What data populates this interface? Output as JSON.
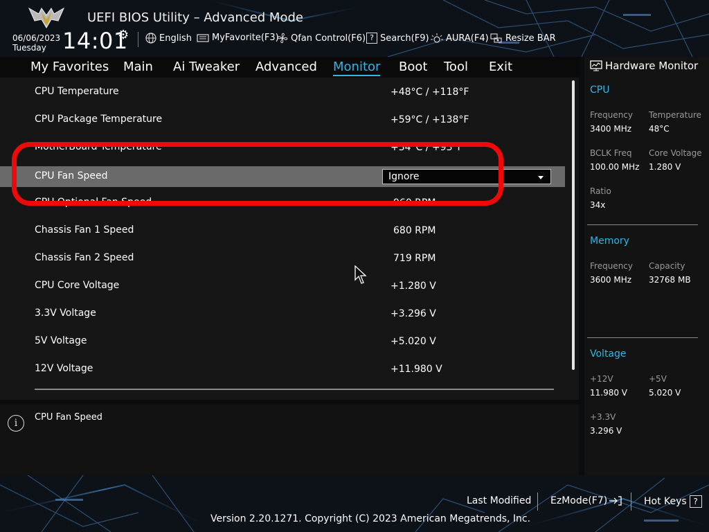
{
  "header": {
    "title": "UEFI BIOS Utility – Advanced Mode",
    "date": "06/06/2023",
    "day": "Tuesday",
    "time": "14:01",
    "items": [
      {
        "label": "English",
        "icon": "globe-icon"
      },
      {
        "label": "MyFavorite(F3)",
        "icon": "keyboard-icon"
      },
      {
        "label": "Qfan Control(F6)",
        "icon": "fan-icon"
      },
      {
        "label": "Search(F9)",
        "icon": "search-icon"
      },
      {
        "label": "AURA(F4)",
        "icon": "aura-icon"
      },
      {
        "label": "Resize BAR",
        "icon": "resize-bar-icon"
      }
    ]
  },
  "tabs": [
    {
      "label": "My Favorites",
      "active": false
    },
    {
      "label": "Main",
      "active": false
    },
    {
      "label": "Ai Tweaker",
      "active": false
    },
    {
      "label": "Advanced",
      "active": false
    },
    {
      "label": "Monitor",
      "active": true
    },
    {
      "label": "Boot",
      "active": false
    },
    {
      "label": "Tool",
      "active": false
    },
    {
      "label": "Exit",
      "active": false
    }
  ],
  "monitor": {
    "rows": [
      {
        "label": "CPU Temperature",
        "value": "+48°C / +118°F"
      },
      {
        "label": "CPU Package Temperature",
        "value": "+59°C / +138°F"
      },
      {
        "label": "MotherBoard Temperature",
        "value": "+34°C / +93°F"
      },
      {
        "label": "CPU Fan Speed",
        "value": "Ignore"
      },
      {
        "label": "CPU Optional Fan Speed",
        "value": "960 RPM"
      },
      {
        "label": "Chassis Fan 1 Speed",
        "value": "680 RPM"
      },
      {
        "label": "Chassis Fan 2 Speed",
        "value": "719 RPM"
      },
      {
        "label": "CPU Core Voltage",
        "value": "+1.280 V"
      },
      {
        "label": "3.3V Voltage",
        "value": "+3.296 V"
      },
      {
        "label": "5V Voltage",
        "value": "+5.020 V"
      },
      {
        "label": "12V Voltage",
        "value": "+11.980 V"
      }
    ],
    "help_text": "CPU Fan Speed"
  },
  "hardware_monitor": {
    "title": "Hardware Monitor",
    "cpu": {
      "heading": "CPU",
      "frequency_label": "Frequency",
      "frequency": "3400 MHz",
      "temperature_label": "Temperature",
      "temperature": "48°C",
      "bclk_label": "BCLK Freq",
      "bclk": "100.00 MHz",
      "core_voltage_label": "Core Voltage",
      "core_voltage": "1.280 V",
      "ratio_label": "Ratio",
      "ratio": "34x"
    },
    "memory": {
      "heading": "Memory",
      "frequency_label": "Frequency",
      "frequency": "3600 MHz",
      "capacity_label": "Capacity",
      "capacity": "32768 MB"
    },
    "voltage": {
      "heading": "Voltage",
      "v12_label": "+12V",
      "v12": "11.980 V",
      "v5_label": "+5V",
      "v5": "5.020 V",
      "v33_label": "+3.3V",
      "v33": "3.296 V"
    }
  },
  "footer": {
    "last_modified": "Last Modified",
    "ezmode": "EzMode(F7)",
    "hotkeys": "Hot Keys",
    "hotkeys_badge": "?",
    "copyright": "Version 2.20.1271. Copyright (C) 2023 American Megatrends, Inc."
  },
  "colors": {
    "accent": "#2fb6e8",
    "highlight": "#ee0a0a",
    "selected_row": "#6a6a6a"
  }
}
